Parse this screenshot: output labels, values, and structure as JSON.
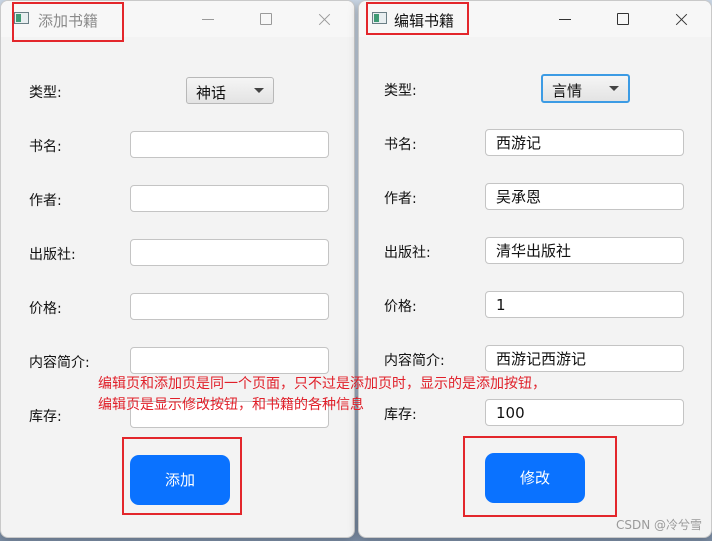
{
  "add_window": {
    "title": "添加书籍",
    "type_label": "类型:",
    "type_value": "神话",
    "fields": [
      {
        "label": "书名:",
        "value": ""
      },
      {
        "label": "作者:",
        "value": ""
      },
      {
        "label": "出版社:",
        "value": ""
      },
      {
        "label": "价格:",
        "value": ""
      },
      {
        "label": "内容简介:",
        "value": ""
      },
      {
        "label": "库存:",
        "value": ""
      }
    ],
    "action_button": "添加"
  },
  "edit_window": {
    "title": "编辑书籍",
    "type_label": "类型:",
    "type_value": "言情",
    "fields": [
      {
        "label": "书名:",
        "value": "西游记"
      },
      {
        "label": "作者:",
        "value": "吴承恩"
      },
      {
        "label": "出版社:",
        "value": "清华出版社"
      },
      {
        "label": "价格:",
        "value": "1"
      },
      {
        "label": "内容简介:",
        "value": "西游记西游记"
      },
      {
        "label": "库存:",
        "value": "100"
      }
    ],
    "action_button": "修改"
  },
  "annotation": {
    "line1": "编辑页和添加页是同一个页面，只不过是添加页时，显示的是添加按钮，",
    "line2": "编辑页是显示修改按钮，和书籍的各种信息"
  },
  "watermark": "CSDN @冷兮雪",
  "colors": {
    "button": "#0a72ff",
    "highlight_box": "#e3262b",
    "annotation_text": "#e0202a"
  }
}
